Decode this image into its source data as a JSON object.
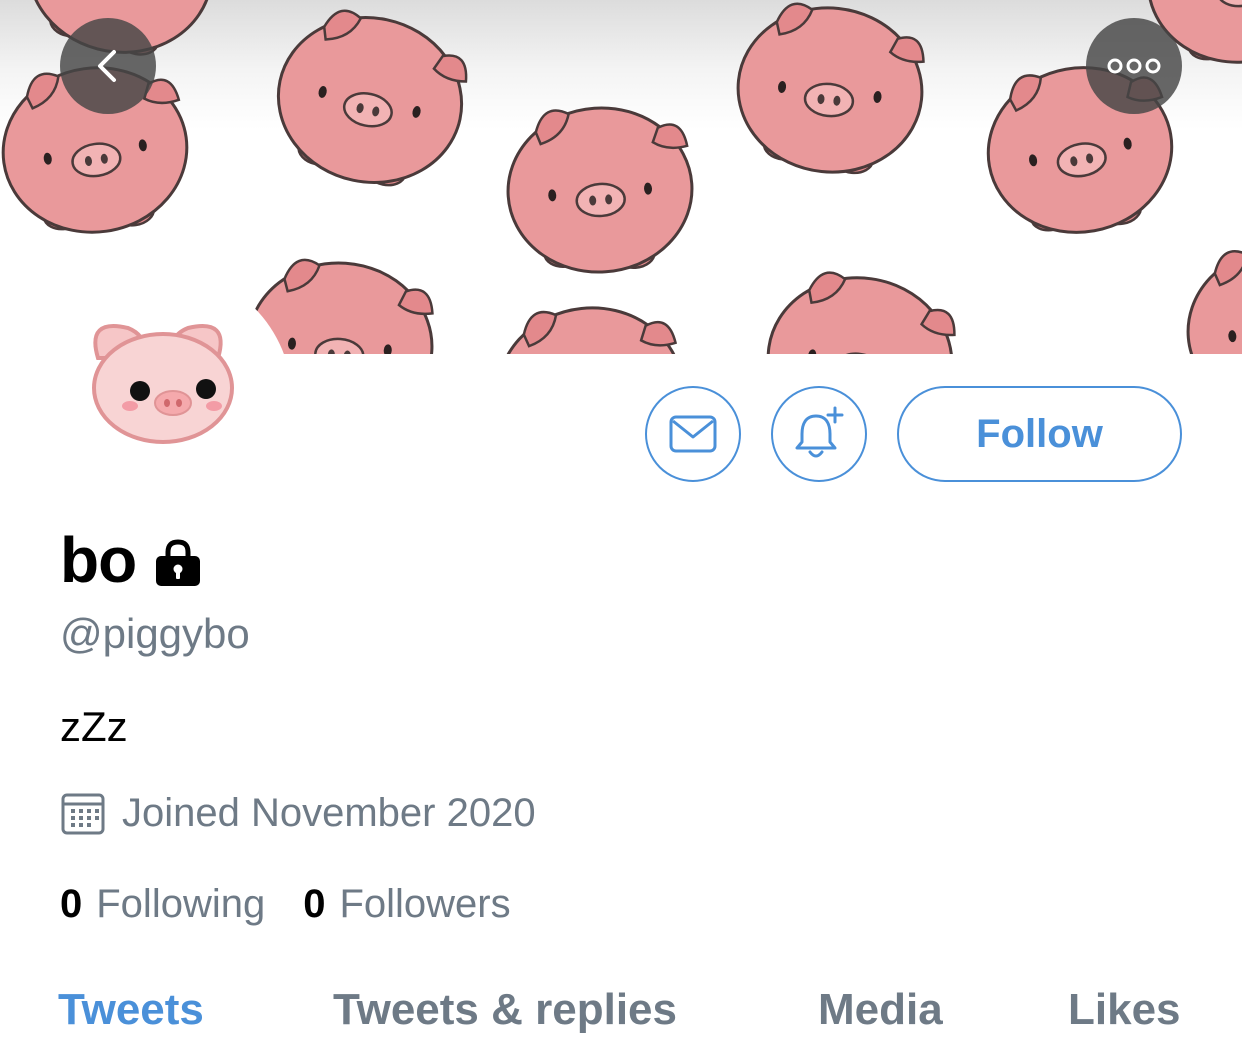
{
  "header": {
    "back_icon": "chevron-left-icon",
    "more_icon": "ellipsis-icon"
  },
  "actions": {
    "message_icon": "envelope-icon",
    "notify_icon": "bell-plus-icon",
    "follow_label": "Follow"
  },
  "profile": {
    "display_name": "bo",
    "protected_icon": "lock-icon",
    "handle": "@piggybo",
    "bio": "zZz",
    "joined": "Joined November 2020",
    "following_count": "0",
    "following_label": "Following",
    "followers_count": "0",
    "followers_label": "Followers"
  },
  "tabs": [
    {
      "label": "Tweets",
      "active": true
    },
    {
      "label": "Tweets & replies",
      "active": false
    },
    {
      "label": "Media",
      "active": false
    },
    {
      "label": "Likes",
      "active": false
    }
  ],
  "colors": {
    "accent": "#4a90d9",
    "secondary_text": "#6e7a86",
    "pig_pink": "#e9999b"
  }
}
